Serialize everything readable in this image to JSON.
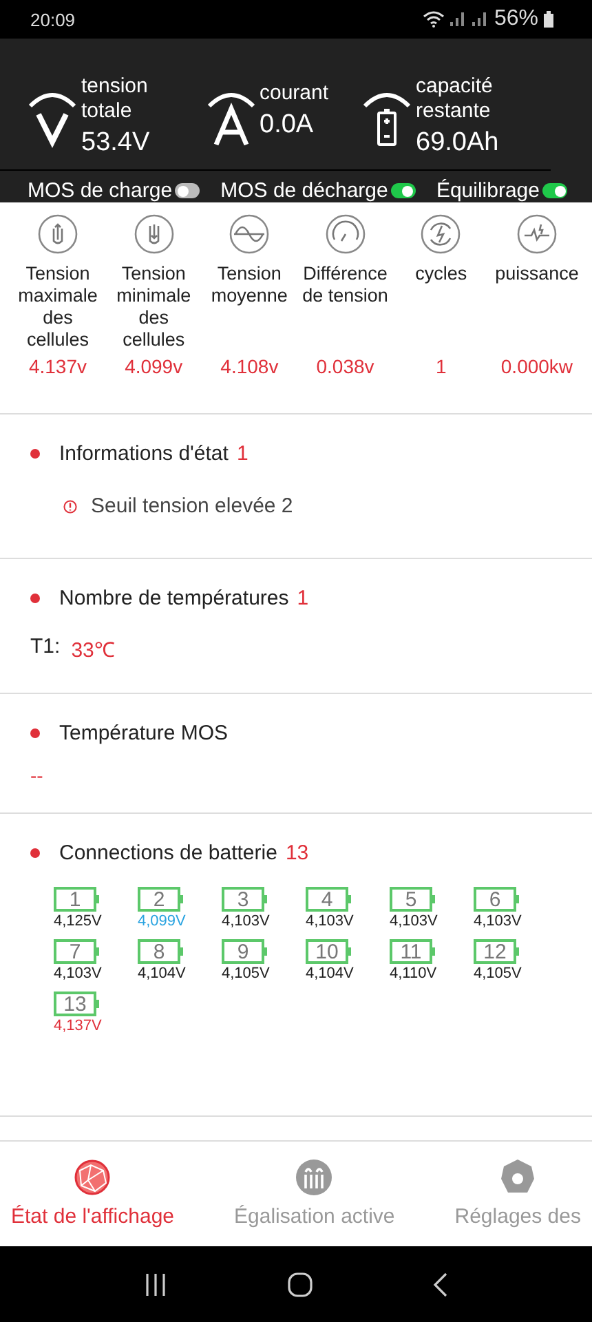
{
  "status_bar": {
    "time": "20:09",
    "battery": "56%"
  },
  "header": {
    "metrics": [
      {
        "kind": "voltage",
        "label": "tension totale",
        "value": "53.4V"
      },
      {
        "kind": "current",
        "label": "courant",
        "value": "0.0A"
      },
      {
        "kind": "capacity",
        "label": "capacité restante",
        "value": "69.0Ah"
      }
    ],
    "toggles": [
      {
        "label": "MOS de charge",
        "on": false
      },
      {
        "label": "MOS de décharge",
        "on": true
      },
      {
        "label": "Équilibrage",
        "on": true
      }
    ]
  },
  "stats": [
    {
      "kind": "max",
      "label": "Tension maximale des cellules",
      "value": "4.137v"
    },
    {
      "kind": "min",
      "label": "Tension minimale des cellules",
      "value": "4.099v"
    },
    {
      "kind": "avg",
      "label": "Tension moyenne",
      "value": "4.108v"
    },
    {
      "kind": "diff",
      "label": "Différence de tension",
      "value": "0.038v"
    },
    {
      "kind": "cycles",
      "label": "cycles",
      "value": "1"
    },
    {
      "kind": "power",
      "label": "puissance",
      "value": "0.000kw"
    }
  ],
  "status_info": {
    "title": "Informations d'état",
    "count": "1",
    "alerts": [
      "Seuil tension elevée 2"
    ]
  },
  "temperatures": {
    "title": "Nombre de températures",
    "count": "1",
    "items": [
      {
        "label": "T1:",
        "value": "33℃"
      }
    ]
  },
  "mos_temperature": {
    "title": "Température MOS",
    "value": "--"
  },
  "cells": {
    "title": "Connections de batterie",
    "count": "13",
    "items": [
      {
        "number": "1",
        "voltage": "4,125V",
        "color": "#222222"
      },
      {
        "number": "2",
        "voltage": "4,099V",
        "color": "#29a3e0"
      },
      {
        "number": "3",
        "voltage": "4,103V",
        "color": "#222222"
      },
      {
        "number": "4",
        "voltage": "4,103V",
        "color": "#222222"
      },
      {
        "number": "5",
        "voltage": "4,103V",
        "color": "#222222"
      },
      {
        "number": "6",
        "voltage": "4,103V",
        "color": "#222222"
      },
      {
        "number": "7",
        "voltage": "4,103V",
        "color": "#222222"
      },
      {
        "number": "8",
        "voltage": "4,104V",
        "color": "#222222"
      },
      {
        "number": "9",
        "voltage": "4,105V",
        "color": "#222222"
      },
      {
        "number": "10",
        "voltage": "4,104V",
        "color": "#222222"
      },
      {
        "number": "11",
        "voltage": "4,110V",
        "color": "#222222"
      },
      {
        "number": "12",
        "voltage": "4,105V",
        "color": "#222222"
      },
      {
        "number": "13",
        "voltage": "4,137V",
        "color": "#e0303a"
      }
    ]
  },
  "bottom_nav": [
    {
      "kind": "display",
      "label": "État de l'affichage",
      "selected": true
    },
    {
      "kind": "balance",
      "label": "Égalisation active",
      "selected": false
    },
    {
      "kind": "settings",
      "label": "Réglages des",
      "selected": false
    }
  ]
}
